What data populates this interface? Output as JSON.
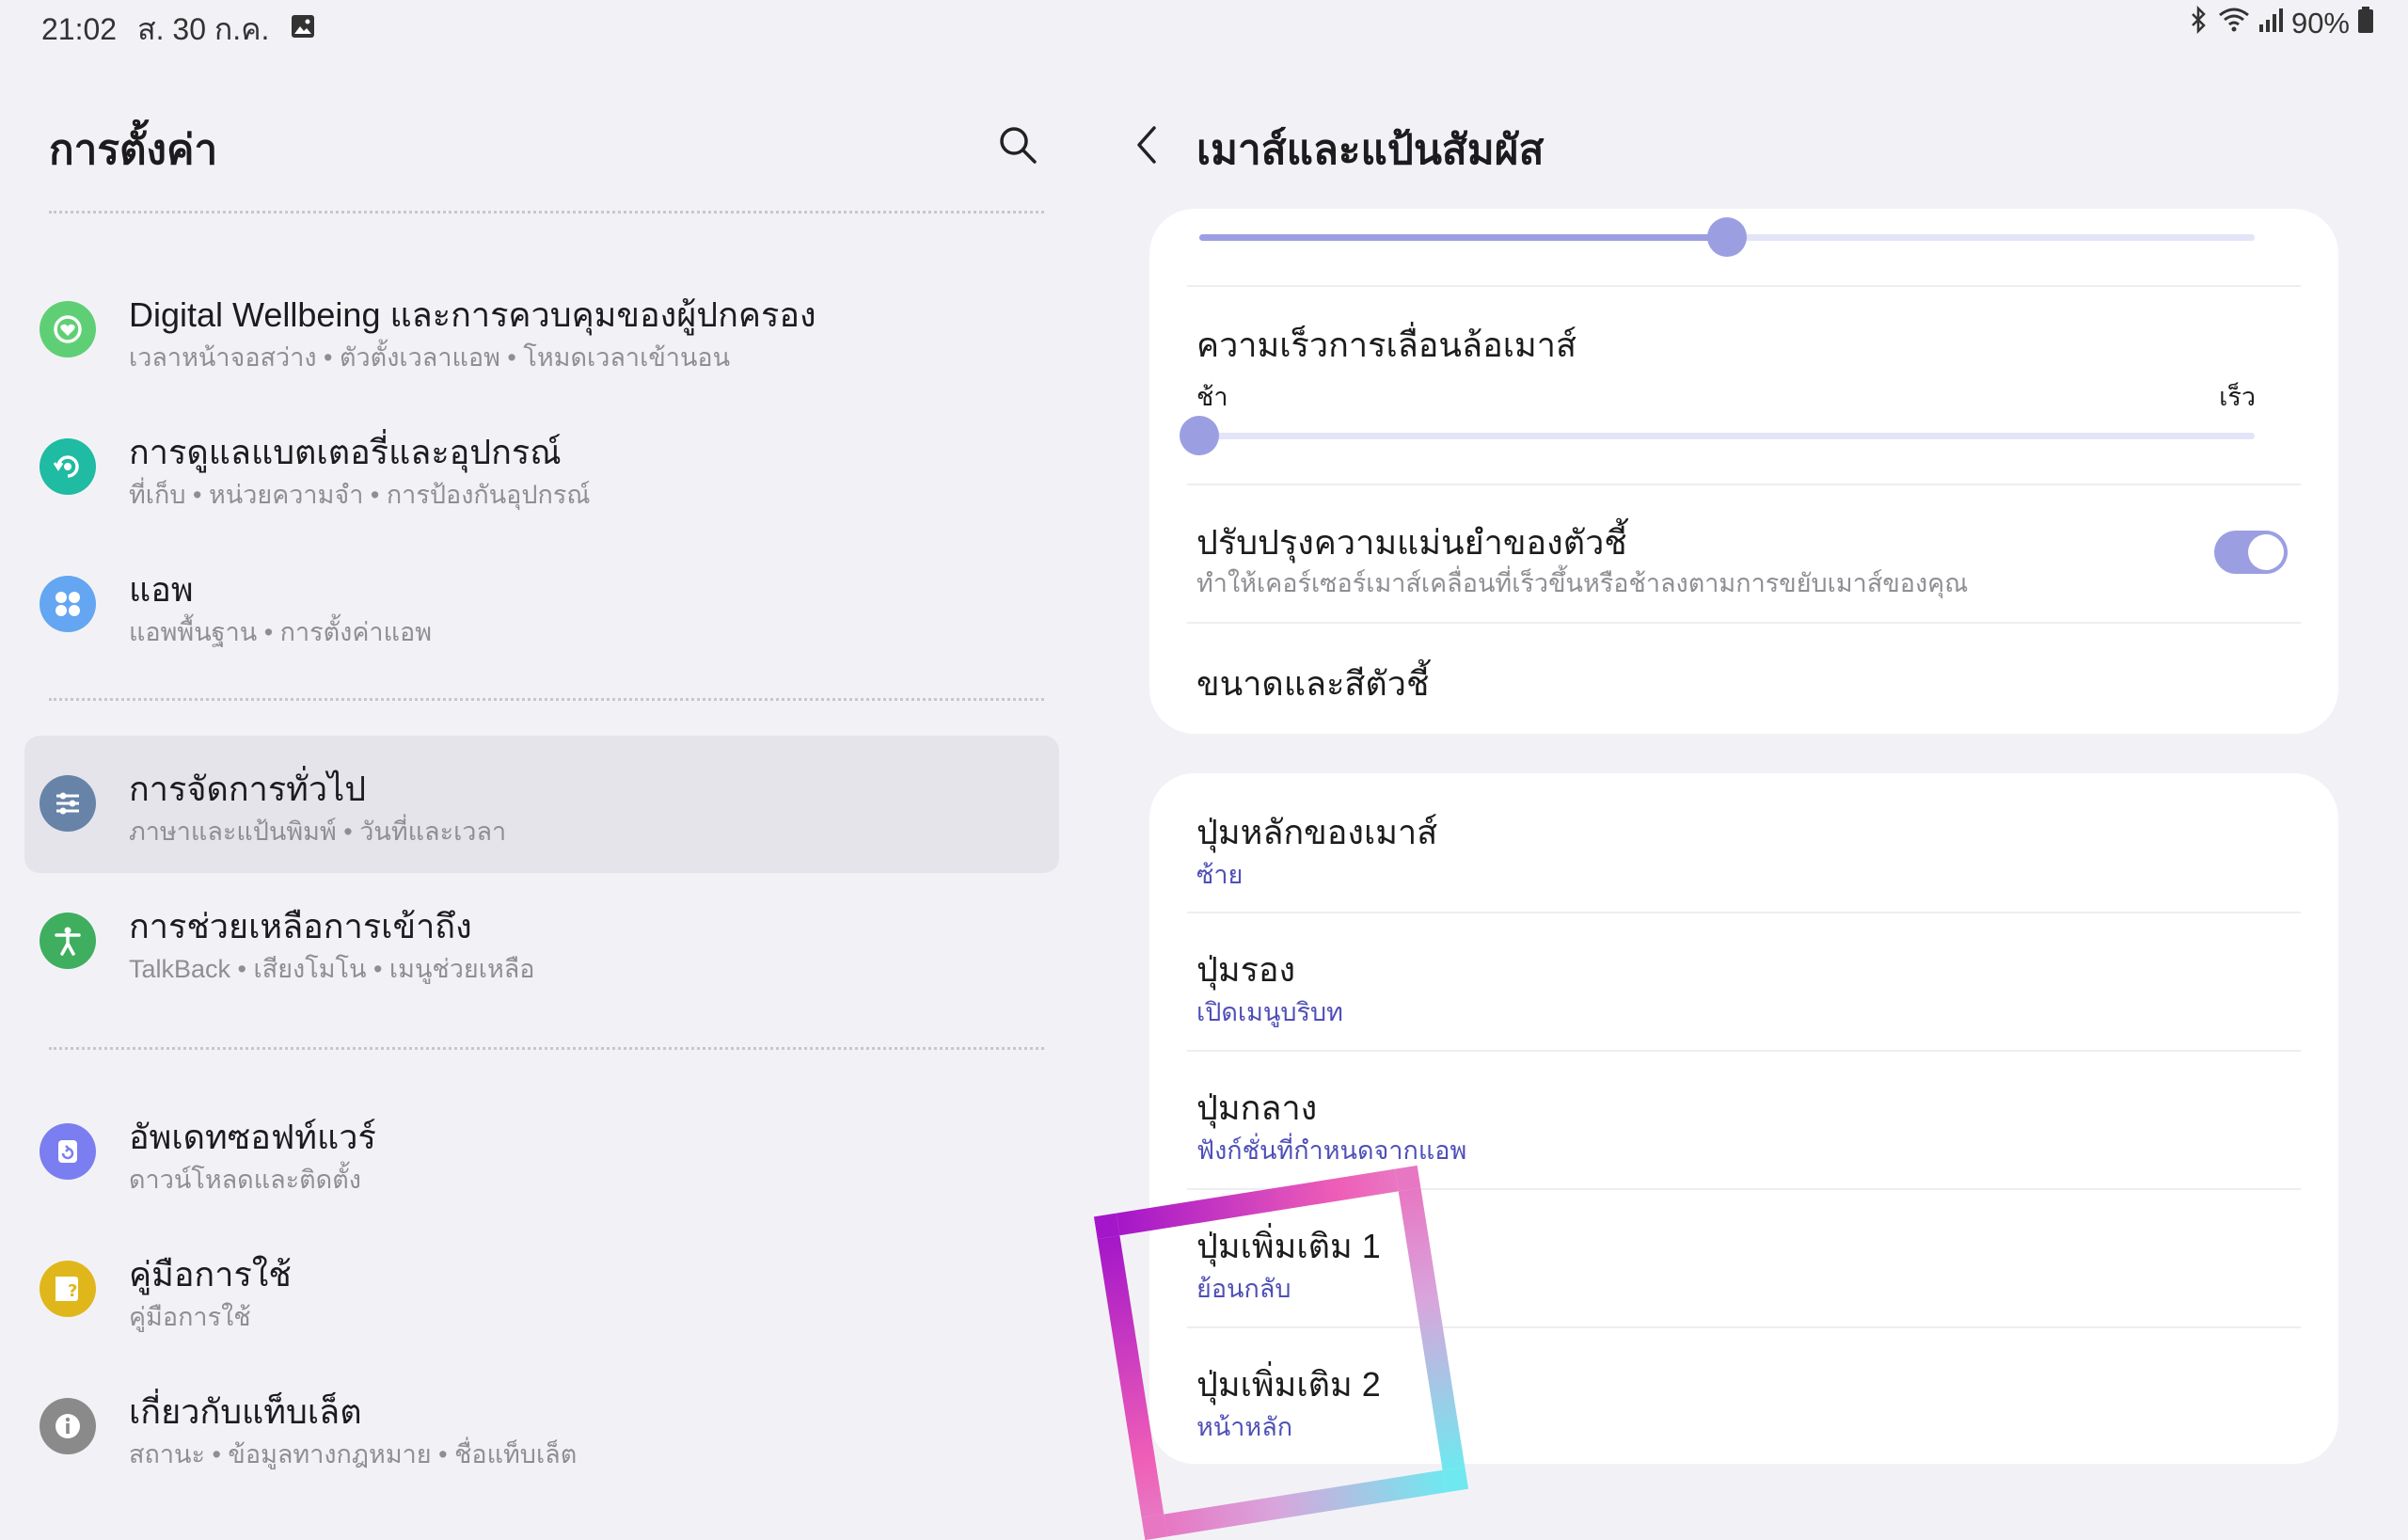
{
  "status_bar": {
    "time": "21:02",
    "date": "ส. 30 ก.ค.",
    "battery": "90%",
    "icons": [
      "gallery-icon",
      "bluetooth-icon",
      "wifi-icon",
      "signal-icon",
      "battery-icon"
    ]
  },
  "left": {
    "title": "การตั้งค่า",
    "search_icon": "search-icon",
    "items": [
      {
        "label": "Digital Wellbeing และการควบคุมของผู้ปกครอง",
        "sub": "เวลาหน้าจอสว่าง  •  ตัวตั้งเวลาแอพ  •  โหมดเวลาเข้านอน",
        "icon": "heart-icon",
        "color": "#5fcf75"
      },
      {
        "label": "การดูแลแบตเตอรี่และอุปกรณ์",
        "sub": "ที่เก็บ  •  หน่วยความจำ  •  การป้องกันอุปกรณ์",
        "icon": "device-care-icon",
        "color": "#1fbba3"
      },
      {
        "label": "แอพ",
        "sub": "แอพพื้นฐาน  •  การตั้งค่าแอพ",
        "icon": "apps-icon",
        "color": "#64a6f2"
      },
      {
        "label": "การจัดการทั่วไป",
        "sub": "ภาษาและแป้นพิมพ์  •  วันที่และเวลา",
        "icon": "sliders-icon",
        "color": "#6783a8"
      },
      {
        "label": "การช่วยเหลือการเข้าถึง",
        "sub": "TalkBack  •  เสียงโมโน  •  เมนูช่วยเหลือ",
        "icon": "accessibility-icon",
        "color": "#3fae5f"
      },
      {
        "label": "อัพเดทซอฟท์แวร์",
        "sub": "ดาวน์โหลดและติดตั้ง",
        "icon": "update-icon",
        "color": "#7a7ef0"
      },
      {
        "label": "คู่มือการใช้",
        "sub": "คู่มือการใช้",
        "icon": "manual-icon",
        "color": "#e0b71a"
      },
      {
        "label": "เกี่ยวกับแท็บเล็ต",
        "sub": "สถานะ  •  ข้อมูลทางกฎหมาย  •  ชื่อแท็บเล็ต",
        "icon": "info-icon",
        "color": "#8a8a8a"
      }
    ]
  },
  "right": {
    "title": "เมาส์และแป้นสัมผัส",
    "back_icon": "back-arrow-icon",
    "pointer_speed_level": 0.5,
    "scroll_speed": {
      "label": "ความเร็วการเลื่อนล้อเมาส์",
      "min_label": "ช้า",
      "max_label": "เร็ว",
      "level": 0.0
    },
    "precision": {
      "label": "ปรับปรุงความแม่นยำของตัวชี้",
      "sub": "ทำให้เคอร์เซอร์เมาส์เคลื่อนที่เร็วขึ้นหรือช้าลงตามการขยับเมาส์ของคุณ",
      "enabled": true
    },
    "pointer_size": {
      "label": "ขนาดและสีตัวชี้"
    },
    "buttons": [
      {
        "label": "ปุ่มหลักของเมาส์",
        "value": "ซ้าย"
      },
      {
        "label": "ปุ่มรอง",
        "value": "เปิดเมนูบริบท"
      },
      {
        "label": "ปุ่มกลาง",
        "value": "ฟังก์ชั่นที่กำหนดจากแอพ"
      },
      {
        "label": "ปุ่มเพิ่มเติม 1",
        "value": "ย้อนกลับ"
      },
      {
        "label": "ปุ่มเพิ่มเติม 2",
        "value": "หน้าหลัก"
      }
    ]
  }
}
